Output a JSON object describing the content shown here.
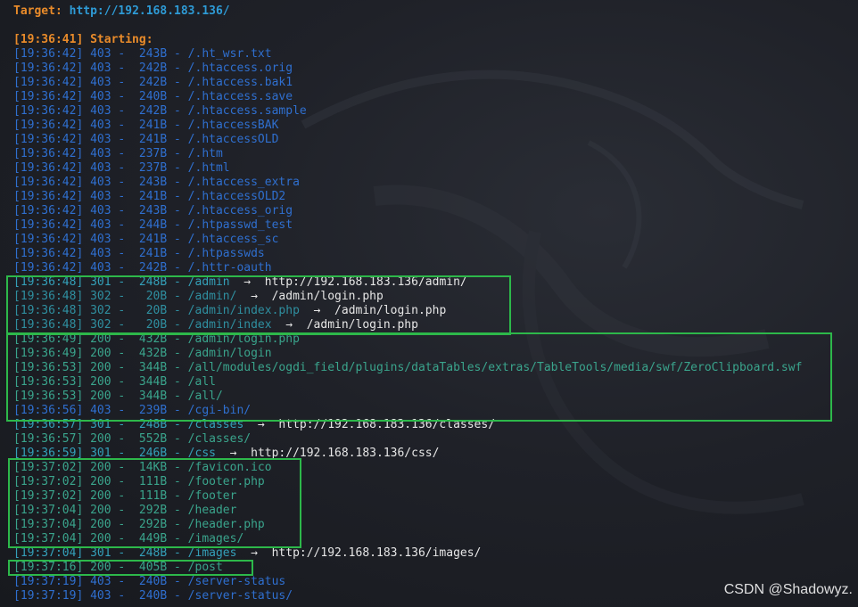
{
  "header": {
    "target_label": "Target:",
    "target_url": "http://192.168.183.136/"
  },
  "start_line": "[19:36:41] Starting:",
  "log": [
    {
      "ts": "[19:36:42]",
      "code": "403",
      "size": "243B",
      "path": "/.ht_wsr.txt",
      "redirect": ""
    },
    {
      "ts": "[19:36:42]",
      "code": "403",
      "size": "242B",
      "path": "/.htaccess.orig",
      "redirect": ""
    },
    {
      "ts": "[19:36:42]",
      "code": "403",
      "size": "242B",
      "path": "/.htaccess.bak1",
      "redirect": ""
    },
    {
      "ts": "[19:36:42]",
      "code": "403",
      "size": "240B",
      "path": "/.htaccess.save",
      "redirect": ""
    },
    {
      "ts": "[19:36:42]",
      "code": "403",
      "size": "242B",
      "path": "/.htaccess.sample",
      "redirect": ""
    },
    {
      "ts": "[19:36:42]",
      "code": "403",
      "size": "241B",
      "path": "/.htaccessBAK",
      "redirect": ""
    },
    {
      "ts": "[19:36:42]",
      "code": "403",
      "size": "241B",
      "path": "/.htaccessOLD",
      "redirect": ""
    },
    {
      "ts": "[19:36:42]",
      "code": "403",
      "size": "237B",
      "path": "/.htm",
      "redirect": ""
    },
    {
      "ts": "[19:36:42]",
      "code": "403",
      "size": "237B",
      "path": "/.html",
      "redirect": ""
    },
    {
      "ts": "[19:36:42]",
      "code": "403",
      "size": "243B",
      "path": "/.htaccess_extra",
      "redirect": ""
    },
    {
      "ts": "[19:36:42]",
      "code": "403",
      "size": "241B",
      "path": "/.htaccessOLD2",
      "redirect": ""
    },
    {
      "ts": "[19:36:42]",
      "code": "403",
      "size": "243B",
      "path": "/.htaccess_orig",
      "redirect": ""
    },
    {
      "ts": "[19:36:42]",
      "code": "403",
      "size": "244B",
      "path": "/.htpasswd_test",
      "redirect": ""
    },
    {
      "ts": "[19:36:42]",
      "code": "403",
      "size": "241B",
      "path": "/.htaccess_sc",
      "redirect": ""
    },
    {
      "ts": "[19:36:42]",
      "code": "403",
      "size": "241B",
      "path": "/.htpasswds",
      "redirect": ""
    },
    {
      "ts": "[19:36:42]",
      "code": "403",
      "size": "242B",
      "path": "/.httr-oauth",
      "redirect": ""
    },
    {
      "ts": "[19:36:48]",
      "code": "301",
      "size": "248B",
      "path": "/admin",
      "redirect": "http://192.168.183.136/admin/"
    },
    {
      "ts": "[19:36:48]",
      "code": "302",
      "size": "20B",
      "path": "/admin/",
      "redirect": "/admin/login.php"
    },
    {
      "ts": "[19:36:48]",
      "code": "302",
      "size": "20B",
      "path": "/admin/index.php",
      "redirect": "/admin/login.php"
    },
    {
      "ts": "[19:36:48]",
      "code": "302",
      "size": "20B",
      "path": "/admin/index",
      "redirect": "/admin/login.php"
    },
    {
      "ts": "[19:36:49]",
      "code": "200",
      "size": "432B",
      "path": "/admin/login.php",
      "redirect": ""
    },
    {
      "ts": "[19:36:49]",
      "code": "200",
      "size": "432B",
      "path": "/admin/login",
      "redirect": ""
    },
    {
      "ts": "[19:36:53]",
      "code": "200",
      "size": "344B",
      "path": "/all/modules/ogdi_field/plugins/dataTables/extras/TableTools/media/swf/ZeroClipboard.swf",
      "redirect": ""
    },
    {
      "ts": "[19:36:53]",
      "code": "200",
      "size": "344B",
      "path": "/all",
      "redirect": ""
    },
    {
      "ts": "[19:36:53]",
      "code": "200",
      "size": "344B",
      "path": "/all/",
      "redirect": ""
    },
    {
      "ts": "[19:36:56]",
      "code": "403",
      "size": "239B",
      "path": "/cgi-bin/",
      "redirect": ""
    },
    {
      "ts": "[19:36:57]",
      "code": "301",
      "size": "248B",
      "path": "/classes",
      "redirect": "http://192.168.183.136/classes/"
    },
    {
      "ts": "[19:36:57]",
      "code": "200",
      "size": "552B",
      "path": "/classes/",
      "redirect": ""
    },
    {
      "ts": "[19:36:59]",
      "code": "301",
      "size": "246B",
      "path": "/css",
      "redirect": "http://192.168.183.136/css/"
    },
    {
      "ts": "[19:37:02]",
      "code": "200",
      "size": "14KB",
      "path": "/favicon.ico",
      "redirect": ""
    },
    {
      "ts": "[19:37:02]",
      "code": "200",
      "size": "111B",
      "path": "/footer.php",
      "redirect": ""
    },
    {
      "ts": "[19:37:02]",
      "code": "200",
      "size": "111B",
      "path": "/footer",
      "redirect": ""
    },
    {
      "ts": "[19:37:04]",
      "code": "200",
      "size": "292B",
      "path": "/header",
      "redirect": ""
    },
    {
      "ts": "[19:37:04]",
      "code": "200",
      "size": "292B",
      "path": "/header.php",
      "redirect": ""
    },
    {
      "ts": "[19:37:04]",
      "code": "200",
      "size": "449B",
      "path": "/images/",
      "redirect": ""
    },
    {
      "ts": "[19:37:04]",
      "code": "301",
      "size": "248B",
      "path": "/images",
      "redirect": "http://192.168.183.136/images/"
    },
    {
      "ts": "[19:37:16]",
      "code": "200",
      "size": "405B",
      "path": "/post",
      "redirect": ""
    },
    {
      "ts": "[19:37:19]",
      "code": "403",
      "size": "240B",
      "path": "/server-status",
      "redirect": ""
    },
    {
      "ts": "[19:37:19]",
      "code": "403",
      "size": "240B",
      "path": "/server-status/",
      "redirect": ""
    }
  ],
  "arrow": "→",
  "watermark": "CSDN @Shadowyz.",
  "colors": {
    "orange": "#e98b2a",
    "blue_403": "#2f6fcf",
    "teal_301": "#34a0b9",
    "teal_302": "#2f8fa0",
    "green_200": "#3aa48c",
    "highlight_box": "#2db84a"
  }
}
